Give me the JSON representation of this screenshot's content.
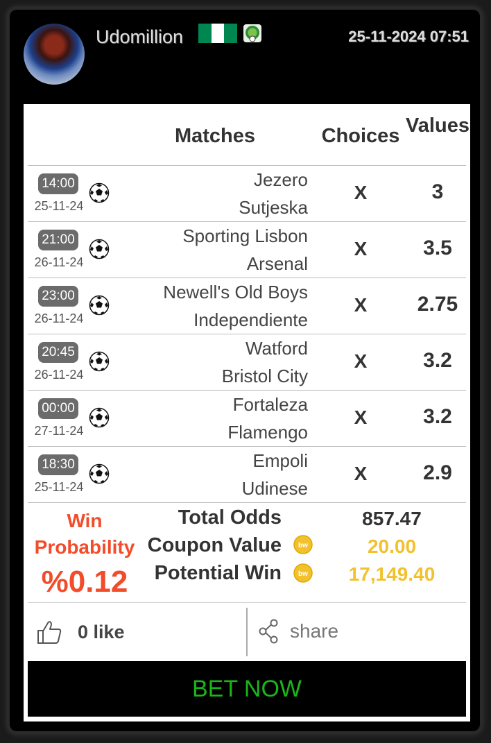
{
  "header": {
    "username": "Udomillion",
    "datetime": "25-11-2024 07:51",
    "flag_colors": [
      "#008751",
      "#ffffff",
      "#008751"
    ]
  },
  "table": {
    "columns": [
      "Matches",
      "Choices",
      "Values"
    ],
    "rows": [
      {
        "time": "14:00",
        "date": "25-11-24",
        "home": "Jezero",
        "away": "Sutjeska",
        "choice": "X",
        "value": "3"
      },
      {
        "time": "21:00",
        "date": "26-11-24",
        "home": "Sporting Lisbon",
        "away": "Arsenal",
        "choice": "X",
        "value": "3.5"
      },
      {
        "time": "23:00",
        "date": "26-11-24",
        "home": "Newell's Old Boys",
        "away": "Independiente",
        "choice": "X",
        "value": "2.75"
      },
      {
        "time": "20:45",
        "date": "26-11-24",
        "home": "Watford",
        "away": "Bristol City",
        "choice": "X",
        "value": "3.2"
      },
      {
        "time": "00:00",
        "date": "27-11-24",
        "home": "Fortaleza",
        "away": "Flamengo",
        "choice": "X",
        "value": "3.2"
      },
      {
        "time": "18:30",
        "date": "25-11-24",
        "home": "Empoli",
        "away": "Udinese",
        "choice": "X",
        "value": "2.9"
      }
    ]
  },
  "summary": {
    "win_probability_label": "Win Probability",
    "win_probability_value": "%0.12",
    "total_odds_label": "Total Odds",
    "total_odds_value": "857.47",
    "coupon_value_label": "Coupon Value",
    "coupon_value": "20.00",
    "potential_win_label": "Potential Win",
    "potential_win_value": "17,149.40"
  },
  "social": {
    "likes_text": "0 like",
    "share_text": "share"
  },
  "bet_button_label": "BET NOW",
  "colors": {
    "accent_red": "#f24c2a",
    "coin_yellow": "#f2c12e",
    "bet_green": "#19b619"
  },
  "icons": [
    "soccer-ball-icon",
    "coin-icon",
    "thumbs-up-icon",
    "share-icon",
    "flag-icon",
    "badge-icon"
  ]
}
